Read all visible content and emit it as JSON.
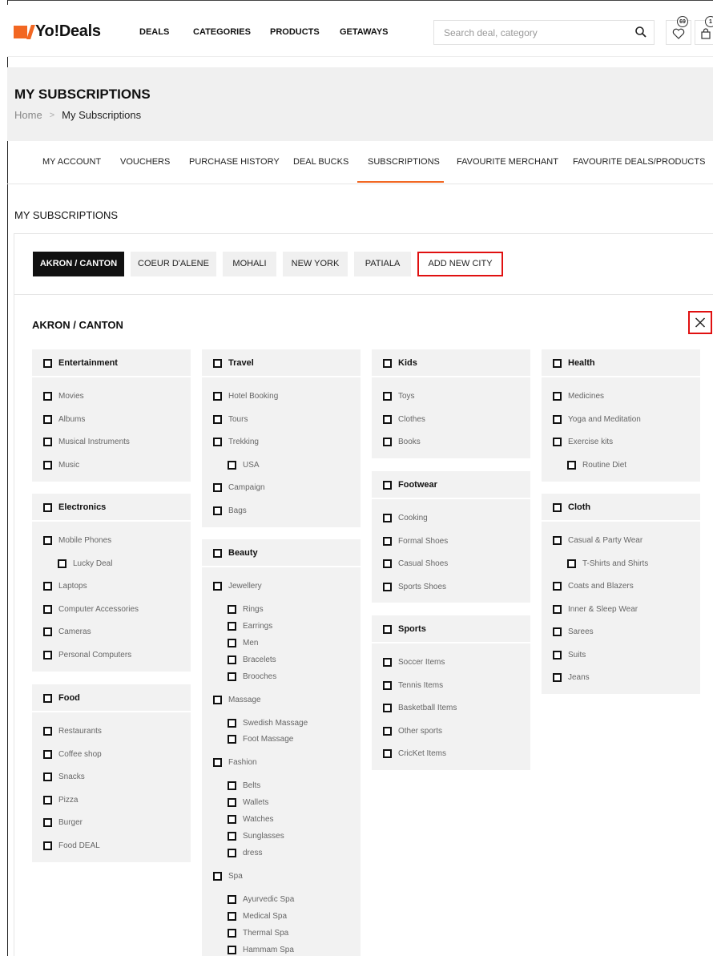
{
  "header": {
    "logo": "Yo!Deals",
    "nav": [
      "DEALS",
      "CATEGORIES",
      "PRODUCTS",
      "GETAWAYS"
    ],
    "search_placeholder": "Search deal, category",
    "wishlist_count": "69",
    "cart_count": "1"
  },
  "page": {
    "title": "MY SUBSCRIPTIONS",
    "breadcrumb_home": "Home",
    "breadcrumb_current": "My Subscriptions"
  },
  "account_tabs": [
    "MY ACCOUNT",
    "VOUCHERS",
    "PURCHASE HISTORY",
    "DEAL BUCKS",
    "SUBSCRIPTIONS",
    "FAVOURITE MERCHANT",
    "FAVOURITE DEALS/PRODUCTS"
  ],
  "active_account_tab": "SUBSCRIPTIONS",
  "section_title": "MY SUBSCRIPTIONS",
  "cities": [
    "AKRON / CANTON",
    "COEUR D'ALENE",
    "MOHALI",
    "NEW YORK",
    "PATIALA"
  ],
  "add_city_label": "ADD NEW CITY",
  "selected_city": "AKRON / CANTON",
  "categories": [
    {
      "name": "Entertainment",
      "items": [
        {
          "label": "Movies"
        },
        {
          "label": "Albums"
        },
        {
          "label": "Musical Instruments"
        },
        {
          "label": "Music"
        }
      ]
    },
    {
      "name": "Electronics",
      "items": [
        {
          "label": "Mobile Phones"
        },
        {
          "label": "Lucky Deal",
          "sub": true
        },
        {
          "label": "Laptops"
        },
        {
          "label": "Computer Accessories"
        },
        {
          "label": "Cameras"
        },
        {
          "label": "Personal Computers"
        }
      ]
    },
    {
      "name": "Food",
      "items": [
        {
          "label": "Restaurants"
        },
        {
          "label": "Coffee shop"
        },
        {
          "label": "Snacks"
        },
        {
          "label": "Pizza"
        },
        {
          "label": "Burger"
        },
        {
          "label": "Food DEAL"
        }
      ]
    },
    {
      "name": "Travel",
      "items": [
        {
          "label": "Hotel Booking"
        },
        {
          "label": "Tours"
        },
        {
          "label": "Trekking"
        },
        {
          "label": "USA",
          "sub": true
        },
        {
          "label": "Campaign"
        },
        {
          "label": "Bags"
        }
      ]
    },
    {
      "name": "Beauty",
      "items": [
        {
          "label": "Jewellery"
        },
        {
          "label": "Rings",
          "sub": true
        },
        {
          "label": "Earrings",
          "sub": true
        },
        {
          "label": "Men",
          "sub": true
        },
        {
          "label": "Bracelets",
          "sub": true
        },
        {
          "label": "Brooches",
          "sub": true
        },
        {
          "label": "Massage"
        },
        {
          "label": "Swedish Massage",
          "sub": true
        },
        {
          "label": "Foot Massage",
          "sub": true
        },
        {
          "label": "Fashion"
        },
        {
          "label": "Belts",
          "sub": true
        },
        {
          "label": "Wallets",
          "sub": true
        },
        {
          "label": "Watches",
          "sub": true
        },
        {
          "label": "Sunglasses",
          "sub": true
        },
        {
          "label": "dress",
          "sub": true
        },
        {
          "label": "Spa"
        },
        {
          "label": "Ayurvedic Spa",
          "sub": true
        },
        {
          "label": "Medical Spa",
          "sub": true
        },
        {
          "label": "Thermal Spa",
          "sub": true
        },
        {
          "label": "Hammam Spa",
          "sub": true
        }
      ]
    },
    {
      "name": "Kids",
      "items": [
        {
          "label": "Toys"
        },
        {
          "label": "Clothes"
        },
        {
          "label": "Books"
        }
      ]
    },
    {
      "name": "Footwear",
      "items": [
        {
          "label": "Cooking"
        },
        {
          "label": "Formal Shoes"
        },
        {
          "label": "Casual Shoes"
        },
        {
          "label": "Sports Shoes"
        }
      ]
    },
    {
      "name": "Sports",
      "items": [
        {
          "label": "Soccer Items"
        },
        {
          "label": "Tennis Items"
        },
        {
          "label": "Basketball Items"
        },
        {
          "label": "Other sports"
        },
        {
          "label": "CricKet Items"
        }
      ]
    },
    {
      "name": "Health",
      "items": [
        {
          "label": "Medicines"
        },
        {
          "label": "Yoga and Meditation"
        },
        {
          "label": "Exercise kits"
        },
        {
          "label": "Routine Diet",
          "sub": true
        }
      ]
    },
    {
      "name": "Cloth",
      "items": [
        {
          "label": "Casual & Party Wear"
        },
        {
          "label": "T-Shirts and Shirts",
          "sub": true
        },
        {
          "label": "Coats and Blazers"
        },
        {
          "label": "Inner & Sleep Wear"
        },
        {
          "label": "Sarees"
        },
        {
          "label": "Suits"
        },
        {
          "label": "Jeans"
        }
      ]
    }
  ],
  "colors": {
    "accent": "#f26722",
    "highlight": "#e01010"
  }
}
